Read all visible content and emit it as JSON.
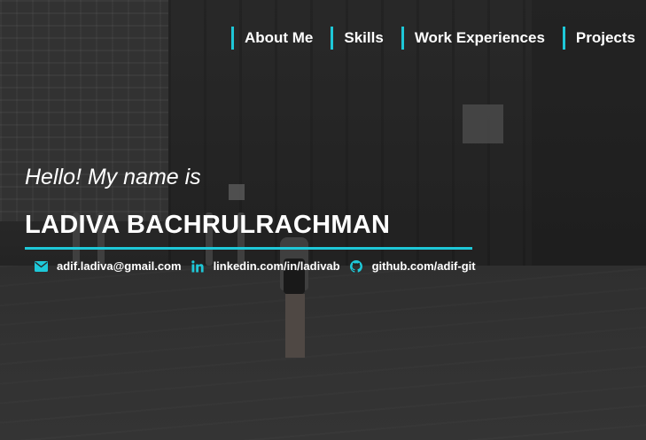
{
  "theme": {
    "accent": "#1ec8d8",
    "text": "#ffffff",
    "background": "#2e2e2e"
  },
  "nav": {
    "items": [
      {
        "label": "About Me"
      },
      {
        "label": "Skills"
      },
      {
        "label": "Work Experiences"
      },
      {
        "label": "Projects"
      }
    ]
  },
  "intro": {
    "greeting": "Hello! My name is",
    "name": "LADIVA BACHRULRACHMAN"
  },
  "contacts": {
    "email": {
      "icon": "envelope-icon",
      "text": "adif.ladiva@gmail.com"
    },
    "linkedin": {
      "icon": "linkedin-icon",
      "text": "linkedin.com/in/ladivab"
    },
    "github": {
      "icon": "github-icon",
      "text": "github.com/adif-git"
    }
  }
}
